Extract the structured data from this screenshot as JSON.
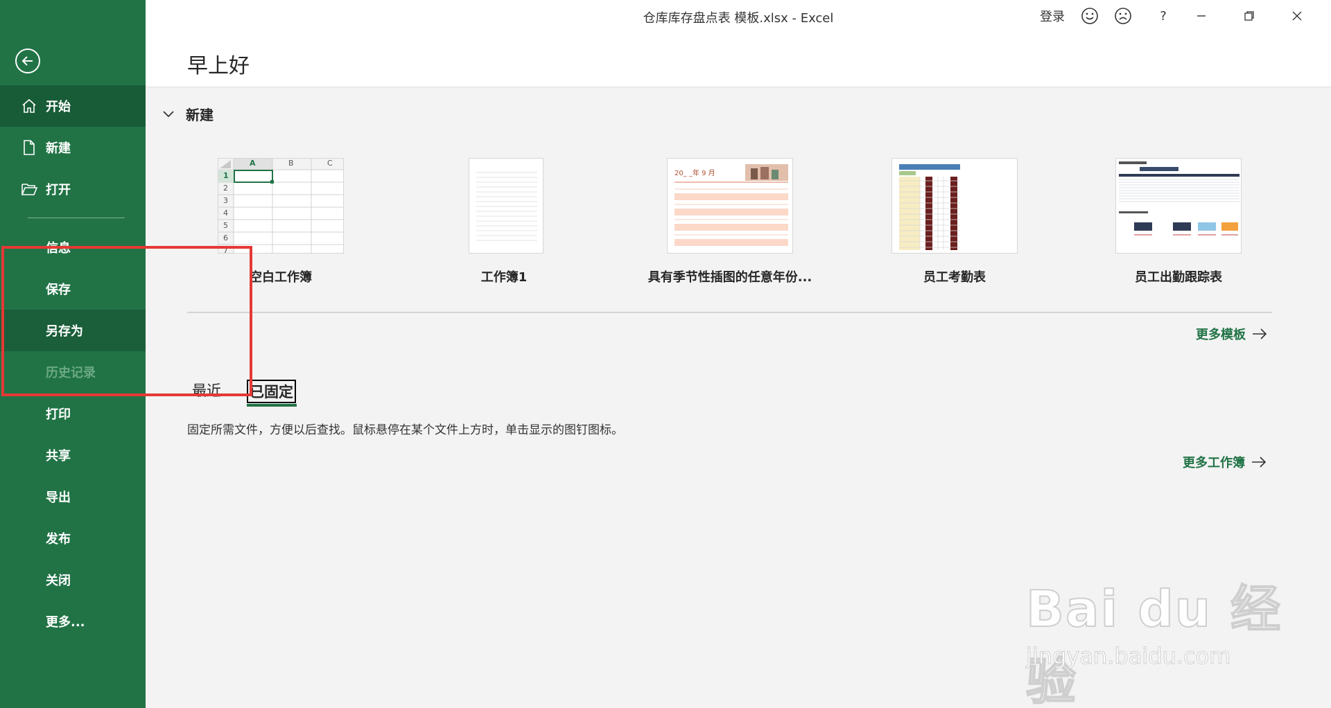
{
  "window": {
    "title": "仓库库存盘点表 模板.xlsx  -  Excel",
    "signin": "登录",
    "help": "?"
  },
  "header": {
    "greeting": "早上好"
  },
  "sidebar": {
    "items": [
      {
        "label": "开始",
        "icon": "home-icon"
      },
      {
        "label": "新建",
        "icon": "new-document-icon"
      },
      {
        "label": "打开",
        "icon": "open-folder-icon"
      },
      {
        "label": "信息"
      },
      {
        "label": "保存"
      },
      {
        "label": "另存为"
      },
      {
        "label": "历史记录"
      },
      {
        "label": "打印"
      },
      {
        "label": "共享"
      },
      {
        "label": "导出"
      },
      {
        "label": "发布"
      },
      {
        "label": "关闭"
      },
      {
        "label": "更多..."
      }
    ]
  },
  "new_section": {
    "title": "新建",
    "templates": [
      {
        "label": "空白工作簿"
      },
      {
        "label": "工作簿1"
      },
      {
        "label": "具有季节性插图的任意年份..."
      },
      {
        "label": "员工考勤表"
      },
      {
        "label": "员工出勤跟踪表"
      }
    ],
    "blank_sheet": {
      "cols": [
        "A",
        "B",
        "C"
      ],
      "rows": [
        "1",
        "2",
        "3",
        "4",
        "5",
        "6",
        "7"
      ]
    },
    "calendar_heading": "20_ _年 9 月",
    "more_templates": "更多模板"
  },
  "files": {
    "tabs": [
      {
        "label": "最近"
      },
      {
        "label": "已固定"
      }
    ],
    "hint": "固定所需文件，方便以后查找。鼠标悬停在某个文件上方时，单击显示的图钉图标。",
    "more_workbooks": "更多工作簿"
  },
  "watermark": {
    "logo": "Bai du 经验",
    "url": "jingyan.baidu.com"
  },
  "colors": {
    "accent": "#217346",
    "sidebar_active": "#185c37",
    "highlight": "#e53935"
  }
}
